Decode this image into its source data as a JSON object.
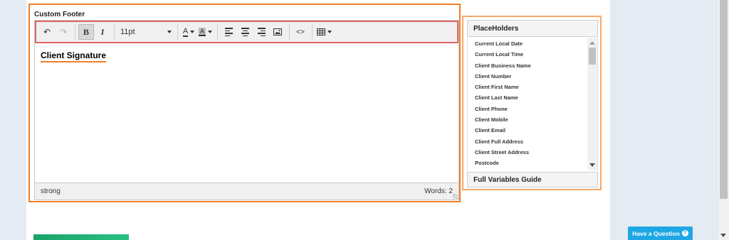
{
  "editor": {
    "title": "Custom Footer",
    "font_size": "11pt",
    "content_text": "Client Signature",
    "status_path": "strong",
    "word_count": "Words: 2"
  },
  "toolbar": {
    "undo_icon": "↶",
    "redo_icon": "↷",
    "bold_icon": "B",
    "italic_icon": "I",
    "text_color_icon": "A",
    "bg_color_icon": "A",
    "code_icon": "<>"
  },
  "placeholders": {
    "title": "PlaceHolders",
    "items": [
      "Current Local Date",
      "Current Local Time",
      "Client Business Name",
      "Client Number",
      "Client First Name",
      "Client Last Name",
      "Client Phone",
      "Client Mobile",
      "Client Email",
      "Client Full Address",
      "Client Street Address",
      "Postcode"
    ],
    "footer": "Full Variables Guide"
  },
  "help": {
    "label": "Have a Question",
    "icon": "?"
  },
  "colors": {
    "accent": "#f07f2b",
    "toolbar_border": "#e06666",
    "help_button": "#1ea7e4"
  }
}
